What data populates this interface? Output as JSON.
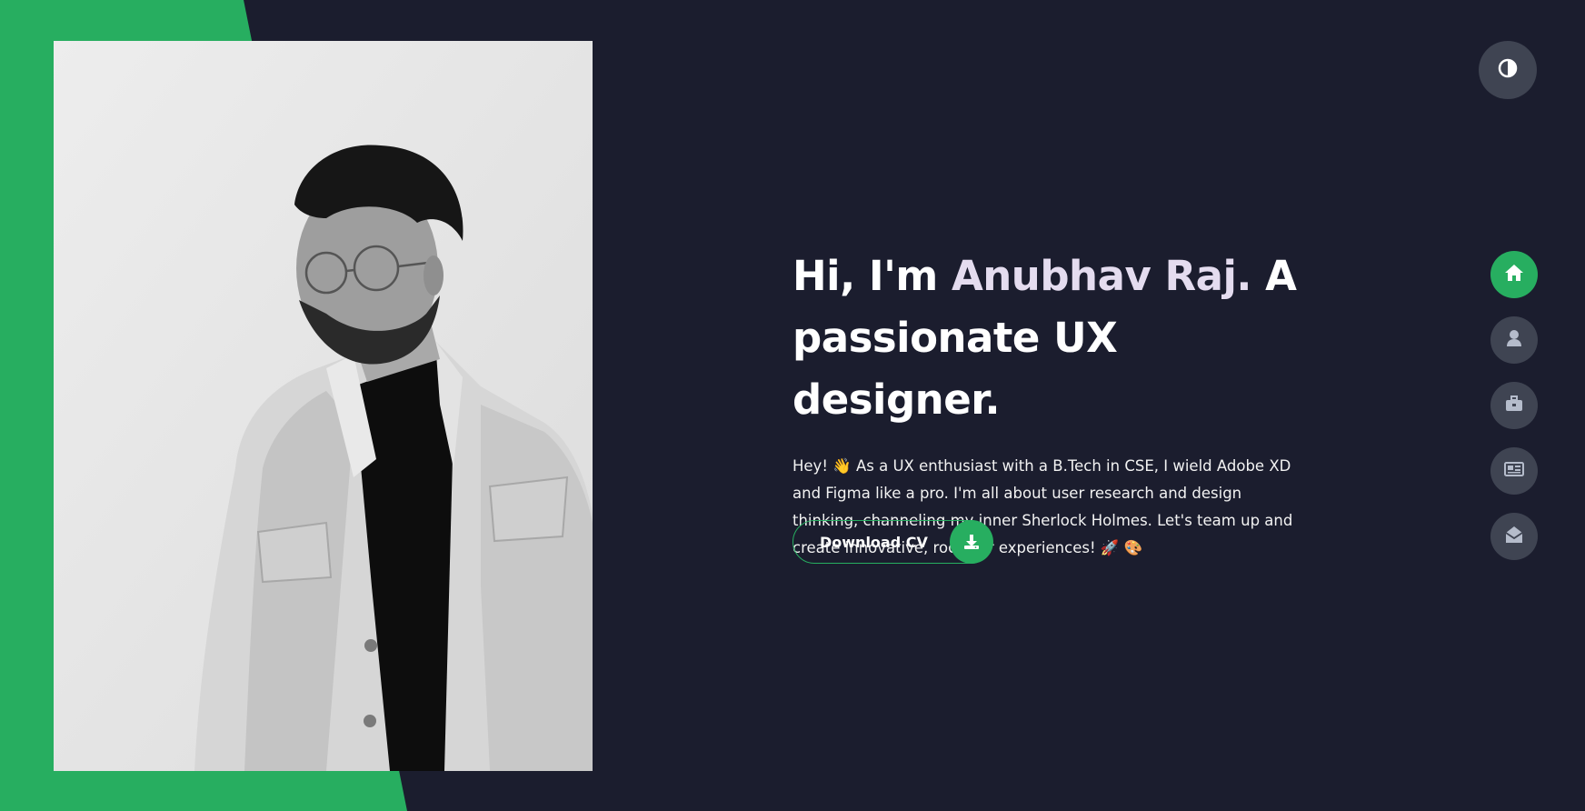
{
  "colors": {
    "background": "#1b1d2e",
    "accent": "#27ae60",
    "name_highlight": "#e4dcef",
    "nav_button": "#3f4452"
  },
  "hero": {
    "headline_prefix": "Hi, I'm ",
    "headline_name": "Anubhav Raj.",
    "headline_suffix": " A passionate UX designer.",
    "intro": "Hey! 👋 As a UX enthusiast with a B.Tech in CSE, I wield Adobe XD and Figma like a pro. I'm all about user research and design thinking, channeling my inner Sherlock Holmes. Let's team up and create innovative, rockstar experiences! 🚀 🎨"
  },
  "cv_button": {
    "label": "Download CV",
    "icon": "download-icon"
  },
  "theme_toggle": {
    "icon": "half-circle-contrast-icon"
  },
  "nav": {
    "items": [
      {
        "id": "home",
        "icon": "home-icon",
        "active": true
      },
      {
        "id": "about",
        "icon": "user-icon",
        "active": false
      },
      {
        "id": "portfolio",
        "icon": "briefcase-icon",
        "active": false
      },
      {
        "id": "blog",
        "icon": "newspaper-icon",
        "active": false
      },
      {
        "id": "contact",
        "icon": "envelope-open-icon",
        "active": false
      }
    ]
  }
}
